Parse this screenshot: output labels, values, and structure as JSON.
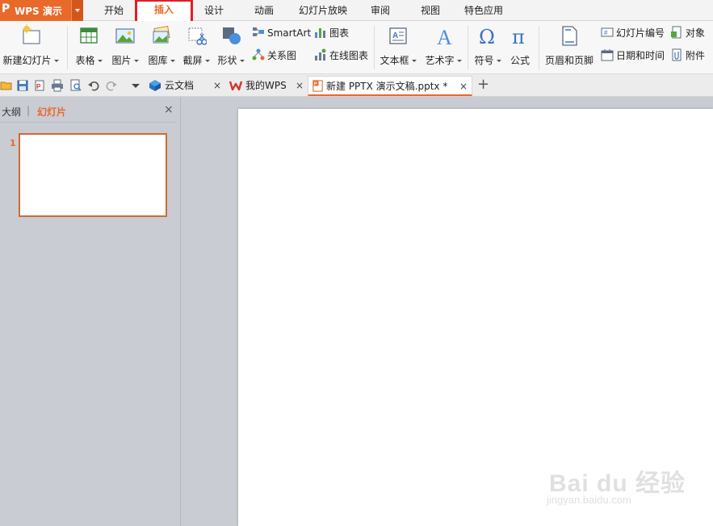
{
  "app": {
    "logo": "P",
    "name": "WPS 演示"
  },
  "menu": {
    "tabs": [
      {
        "label": "开始"
      },
      {
        "label": "插入"
      },
      {
        "label": "设计"
      },
      {
        "label": "动画"
      },
      {
        "label": "幻灯片放映"
      },
      {
        "label": "审阅"
      },
      {
        "label": "视图"
      },
      {
        "label": "特色应用"
      }
    ],
    "active": "插入"
  },
  "ribbon": {
    "new_slide": "新建幻灯片",
    "table": "表格",
    "picture": "图片",
    "gallery": "图库",
    "screenshot": "截屏",
    "shape": "形状",
    "smartart": "SmartArt",
    "relation": "关系图",
    "chart": "图表",
    "online_chart": "在线图表",
    "textbox": "文本框",
    "wordart": "艺术字",
    "symbol": "符号",
    "formula": "公式",
    "header_footer": "页眉和页脚",
    "slide_number": "幻灯片编号",
    "datetime": "日期和时间",
    "object": "对象",
    "attachment": "附件"
  },
  "tabbar": {
    "cloud": "云文档",
    "mywps": "我的WPS",
    "doc": "新建 PPTX 演示文稿.pptx *",
    "close_glyph": "×",
    "add_glyph": "+"
  },
  "leftpanel": {
    "outline": "大纲",
    "divider": "|",
    "slides": "幻灯片",
    "close": "×",
    "thumb_number": "1"
  },
  "watermark": {
    "brand": "Bai du 经验",
    "url": "jingyan.baidu.com"
  },
  "colors": {
    "accent": "#e8692a",
    "highlight_box": "#e11d24",
    "panel_bg": "#c9ccd2"
  }
}
